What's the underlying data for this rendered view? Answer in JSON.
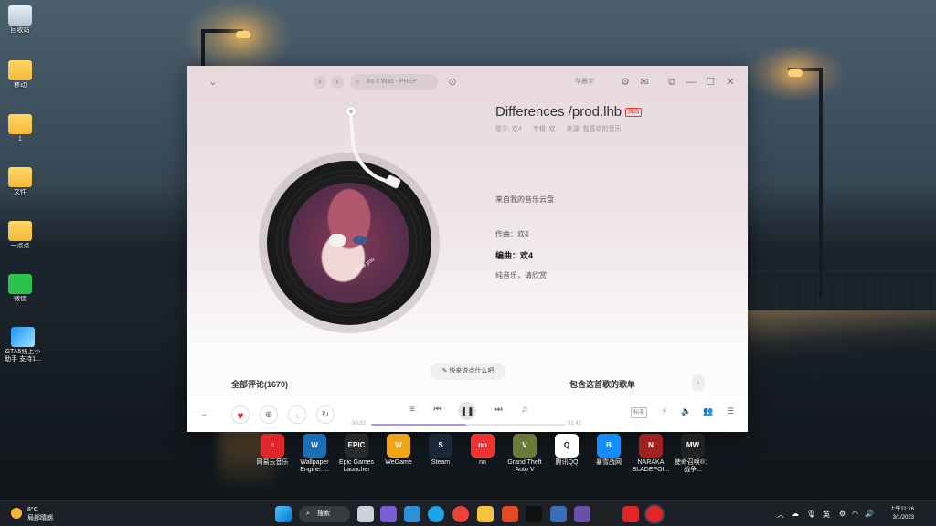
{
  "desktop": {
    "icons": [
      {
        "label": "回收站",
        "type": "recycle"
      },
      {
        "label": "移动",
        "type": "folder"
      },
      {
        "label": "1",
        "type": "folder"
      },
      {
        "label": "文件",
        "type": "folder"
      },
      {
        "label": "一点点",
        "type": "folder"
      },
      {
        "label": "微信",
        "type": "wechat"
      },
      {
        "label": "GTA5线上小助手 支持1...",
        "type": "gta"
      }
    ]
  },
  "player": {
    "search_placeholder": "As It Was - PREP",
    "titlebar_text": "华晨宇",
    "song": {
      "title": "Differences /prod.lhb",
      "badge": "臻品",
      "singer": "歌手: 欢4",
      "album": "专辑: 欢",
      "source": "来源: 我喜欢的音乐"
    },
    "cover_text": "I love you",
    "lyrics": [
      {
        "text": "来自我的音乐云盘",
        "active": false
      },
      {
        "text": "作曲：欢4",
        "active": false
      },
      {
        "text": "编曲：欢4",
        "active": true
      },
      {
        "text": "纯音乐，请欣赏",
        "active": false
      }
    ],
    "comments_label": "全部评论(1670)",
    "comment_prompt": "快来说点什么吧",
    "playlists_label": "包含这首歌的歌单",
    "time_current": "00:52",
    "time_total": "01:45",
    "progress": 0.49,
    "quality_label": "标准"
  },
  "apps": [
    {
      "label": "网易云音乐",
      "color": "#e0262b",
      "glyph": "♫"
    },
    {
      "label": "Wallpaper Engine: ...",
      "color": "#1c6fb3",
      "glyph": "W"
    },
    {
      "label": "Epic Games Launcher",
      "color": "#2a2a2a",
      "glyph": "EPIC"
    },
    {
      "label": "WeGame",
      "color": "#f0a418",
      "glyph": "W"
    },
    {
      "label": "Steam",
      "color": "#1b2838",
      "glyph": "S"
    },
    {
      "label": "nn",
      "color": "#e33",
      "glyph": "nn"
    },
    {
      "label": "Grand Theft Auto V",
      "color": "#6b7a3a",
      "glyph": "V"
    },
    {
      "label": "腾讯QQ",
      "color": "#ffffff",
      "glyph": "Q"
    },
    {
      "label": "暴雪战网",
      "color": "#148eff",
      "glyph": "B"
    },
    {
      "label": "NARAKA BLADEPOI...",
      "color": "#a32020",
      "glyph": "N"
    },
    {
      "label": "使命召唤®：战争...",
      "color": "#222222",
      "glyph": "MW"
    }
  ],
  "taskbar": {
    "weather_temp": "8°C",
    "weather_desc": "局部晴朗",
    "search_label": "搜索",
    "ime_label": "英",
    "time": "上午11:16",
    "date": "3/1/2023"
  }
}
